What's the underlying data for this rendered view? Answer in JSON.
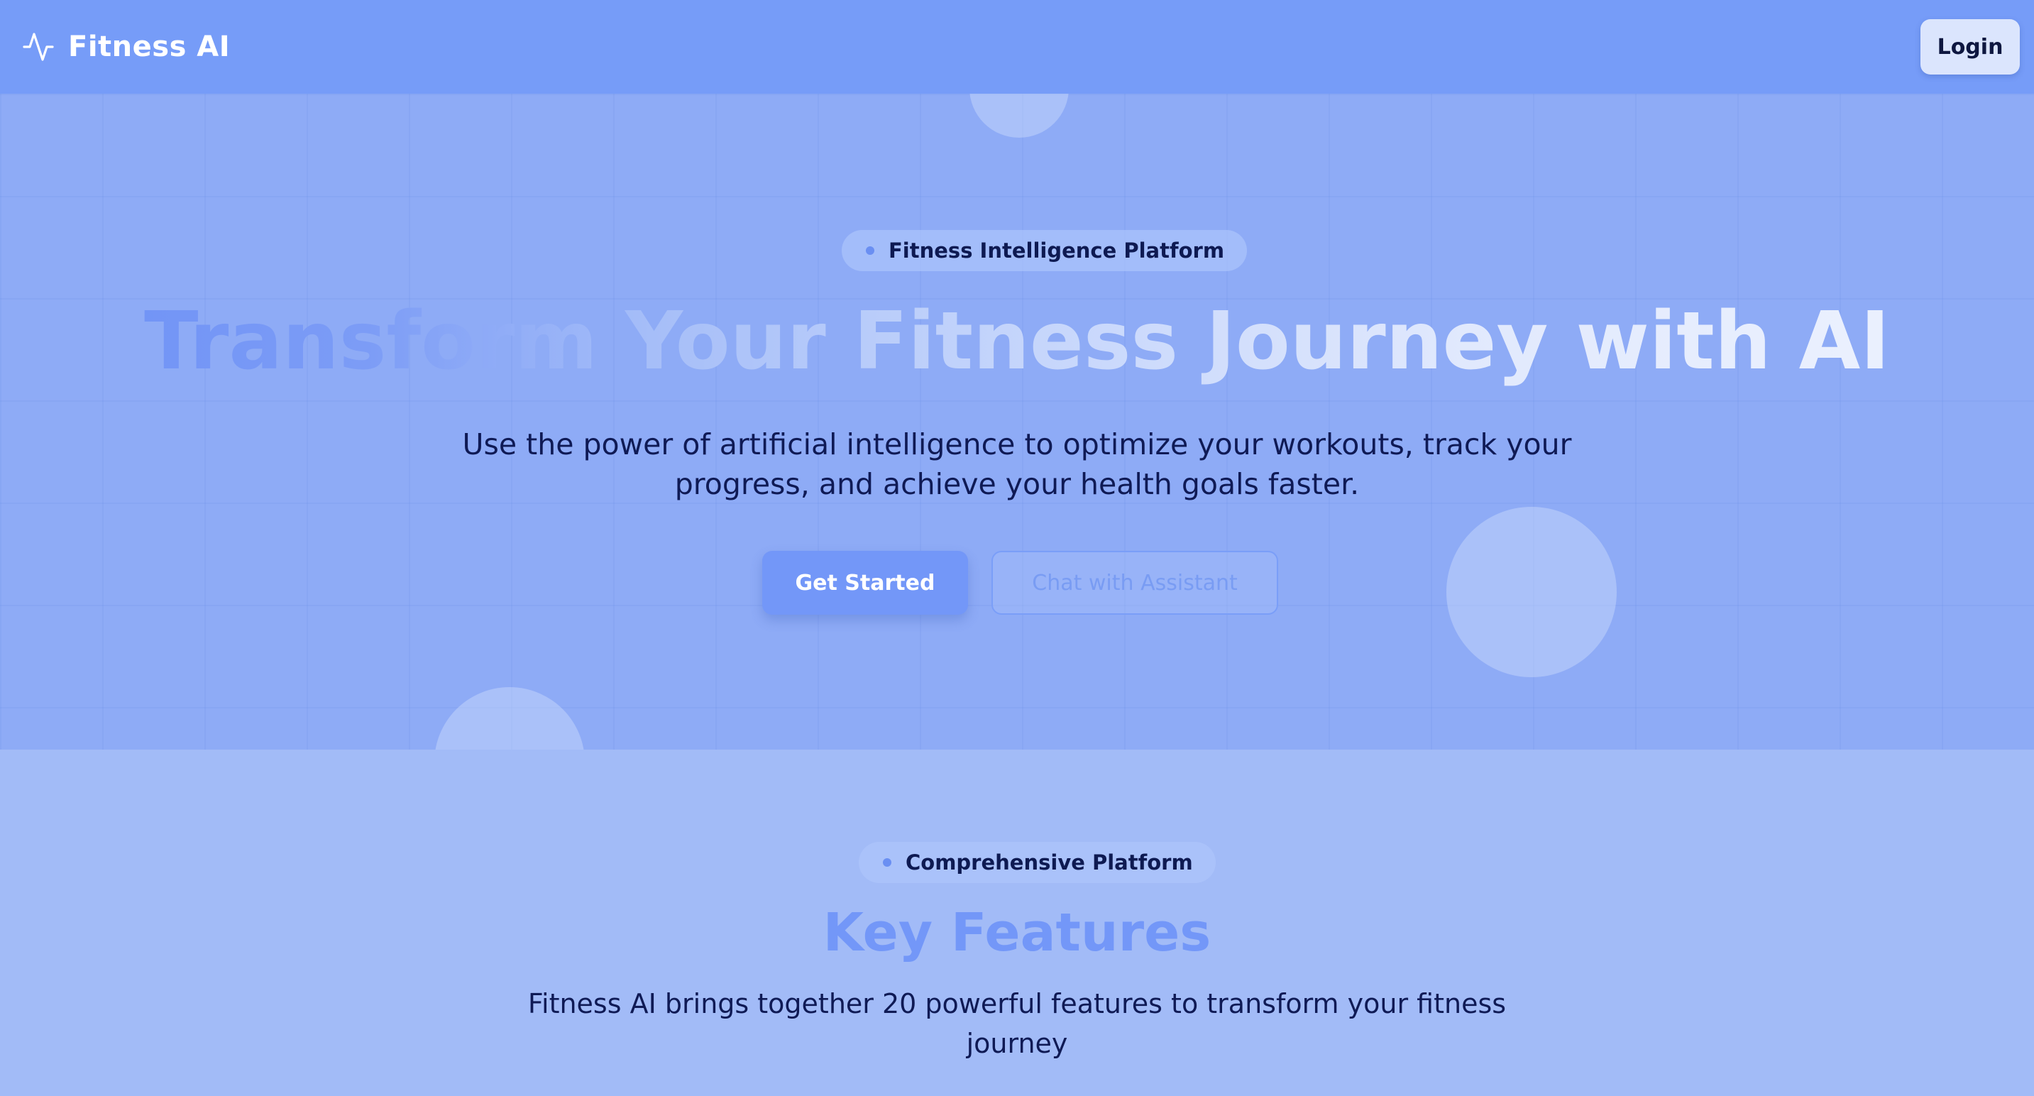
{
  "nav": {
    "brand_name": "Fitness AI",
    "brand_icon": "activity-pulse-icon",
    "login_label": "Login"
  },
  "hero": {
    "badge": "Fitness Intelligence Platform",
    "title": "Transform Your Fitness Journey with AI",
    "subtitle": "Use the power of artificial intelligence to optimize your workouts, track your progress, and achieve your health goals faster.",
    "primary_cta": "Get Started",
    "secondary_cta": "Chat with Assistant"
  },
  "features": {
    "badge": "Comprehensive Platform",
    "title": "Key Features",
    "subtitle": "Fitness AI brings together 20 powerful features to transform your fitness journey"
  },
  "colors": {
    "nav_bg": "#769cf8",
    "hero_bg": "#8eabf6",
    "section_bg": "#a2bbf7",
    "accent": "#7397f8",
    "text_dark": "#0f1a55"
  }
}
